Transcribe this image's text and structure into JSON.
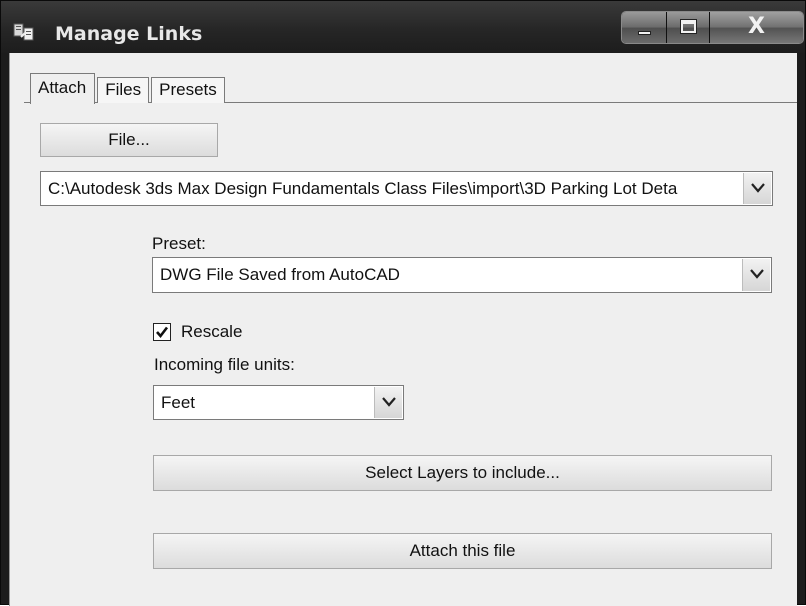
{
  "window": {
    "title": "Manage Links",
    "controls": {
      "minimize": "minimize-icon",
      "maximize": "maximize-icon",
      "close": "X"
    }
  },
  "tabs": [
    {
      "label": "Attach",
      "active": true
    },
    {
      "label": "Files",
      "active": false
    },
    {
      "label": "Presets",
      "active": false
    }
  ],
  "attach": {
    "file_button": "File...",
    "file_path": "C:\\Autodesk 3ds Max Design Fundamentals Class Files\\import\\3D Parking Lot Deta",
    "preset_label": "Preset:",
    "preset_value": "DWG File Saved from AutoCAD",
    "rescale_label": "Rescale",
    "rescale_checked": true,
    "units_label": "Incoming file units:",
    "units_value": "Feet",
    "select_layers_button": "Select Layers to include...",
    "attach_button": "Attach this file"
  },
  "icons": {
    "app": "manage-links-icon",
    "dropdown": "chevron-down-icon",
    "checkbox": "check-icon"
  }
}
